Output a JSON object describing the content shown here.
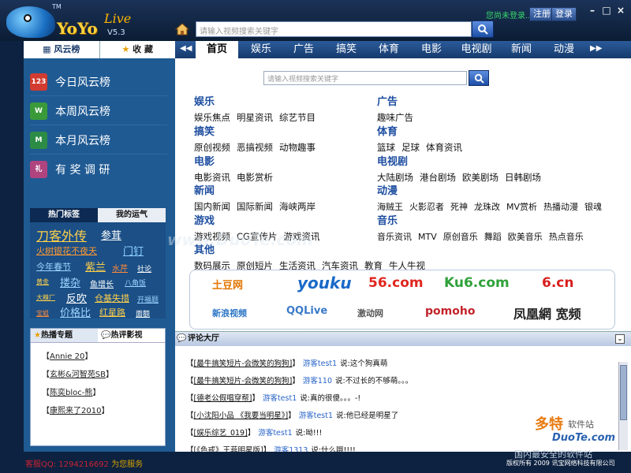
{
  "app": {
    "title": "YoYo",
    "live": "Live",
    "version": "V5.3",
    "tm": "TM"
  },
  "top": {
    "search_placeholder": "请输入视频搜索关键字",
    "login_status": "您尚未登录..",
    "register": "注册",
    "login": "登录",
    "win_min": "–",
    "win_max": "□",
    "win_close": "×"
  },
  "left_tabs": {
    "rank": "风云榜",
    "fav": "收 藏"
  },
  "ranks": [
    {
      "label": "今日风云榜",
      "icon": "123",
      "color": "#d23b2f"
    },
    {
      "label": "本周风云榜",
      "icon": "W",
      "color": "#3a9a3a"
    },
    {
      "label": "本月风云榜",
      "icon": "M",
      "color": "#2c8c46"
    },
    {
      "label": "有 奖 调 研",
      "icon": "礼",
      "color": "#b0447f"
    }
  ],
  "tag_tabs": {
    "hot": "热门标签",
    "luck": "我的运气"
  },
  "tags": [
    "刀客外传",
    "参茸",
    "火树银花不夜天",
    "门钉",
    "今年春节",
    "紫兰",
    "水芹",
    "社论",
    "黄金",
    "搂杂",
    "鱼增长",
    "八角饭",
    "大糗厂",
    "反吹",
    "仓基失措",
    "开福题",
    "宝姐",
    "价格比",
    "红星路",
    "面额"
  ],
  "hot_tabs": {
    "special": "热播专题",
    "review": "热评影视"
  },
  "hot_items": [
    "Annie 20",
    "玄彬&河智苑SB",
    "陈奕bloc-熊",
    "康熙来了2010"
  ],
  "contact": {
    "qq": "客服QQ: 1294216692",
    "service": "为您服务"
  },
  "nav": {
    "prev": "◀◀",
    "next": "▶▶",
    "items": [
      "首页",
      "娱乐",
      "广告",
      "搞笑",
      "体育",
      "电影",
      "电视剧",
      "新闻",
      "动漫"
    ]
  },
  "main_search_placeholder": "请输入视频搜索关键字",
  "categories_left": [
    {
      "title": "娱乐",
      "links": [
        "娱乐焦点",
        "明星资讯",
        "综艺节目"
      ]
    },
    {
      "title": "搞笑",
      "links": [
        "原创视频",
        "恶搞视频",
        "动物趣事"
      ]
    },
    {
      "title": "电影",
      "links": [
        "电影资讯",
        "电影赏析"
      ]
    },
    {
      "title": "新闻",
      "links": [
        "国内新闻",
        "国际新闻",
        "海峡两岸"
      ]
    },
    {
      "title": "游戏",
      "links": [
        "游戏视频",
        "CG宣传片",
        "游戏资讯"
      ]
    },
    {
      "title": "其他",
      "links": [
        "数码展示",
        "原创短片",
        "生活资讯",
        "汽车资讯",
        "教育",
        "牛人牛视"
      ]
    }
  ],
  "categories_right": [
    {
      "title": "广告",
      "links": [
        "趣味广告"
      ]
    },
    {
      "title": "体育",
      "links": [
        "篮球",
        "足球",
        "体育资讯"
      ]
    },
    {
      "title": "电视剧",
      "links": [
        "大陆剧场",
        "港台剧场",
        "欧美剧场",
        "日韩剧场"
      ]
    },
    {
      "title": "动漫",
      "links": [
        "海贼王",
        "火影忍者",
        "死神",
        "龙珠改",
        "MV赏析",
        "热播动漫",
        "银魂"
      ]
    },
    {
      "title": "音乐",
      "links": [
        "音乐资讯",
        "MTV",
        "原创音乐",
        "舞蹈",
        "欧美音乐",
        "热点音乐"
      ]
    }
  ],
  "partners": [
    "土豆网",
    "youku",
    "56.com",
    "Ku6.com",
    "6.cn",
    "新浪视频",
    "QQLive",
    "激动网",
    "pomoho",
    "凤凰網 宽频"
  ],
  "comments": {
    "title": "评论大厅",
    "collapse": "⌄",
    "rows": [
      {
        "title": "[最牛搞笑短片-会微笑的狗狗]",
        "user": "游客test1",
        "text": "说:这个狗真萌"
      },
      {
        "title": "[最牛搞笑短片-会微笑的狗狗]",
        "user": "游客110",
        "text": "说:不过长的不够萌。。。"
      },
      {
        "title": "[德老公假唱穿帮]",
        "user": "游客test1",
        "text": "说:真的很傻。。。-!"
      },
      {
        "title": "[小沈阳小品 《我要当明星》]",
        "user": "游客test1",
        "text": "说:他已经是明星了"
      },
      {
        "title": "[娱乐综艺_019]",
        "user": "游客test1",
        "text": "说:呦!!!"
      },
      {
        "title": "[《色戒》王菲明星版]",
        "user": "游客1313",
        "text": "说:什么哦!!!!"
      }
    ]
  },
  "watermark": "www.DuoTe.com",
  "brand": {
    "name": "多特",
    "sub": "软件站",
    "url": "DuoTe.com",
    "slogan": "国内最安全的软件站",
    "copyright": "版权所有 2009 讯宝网络科技有限公司"
  }
}
